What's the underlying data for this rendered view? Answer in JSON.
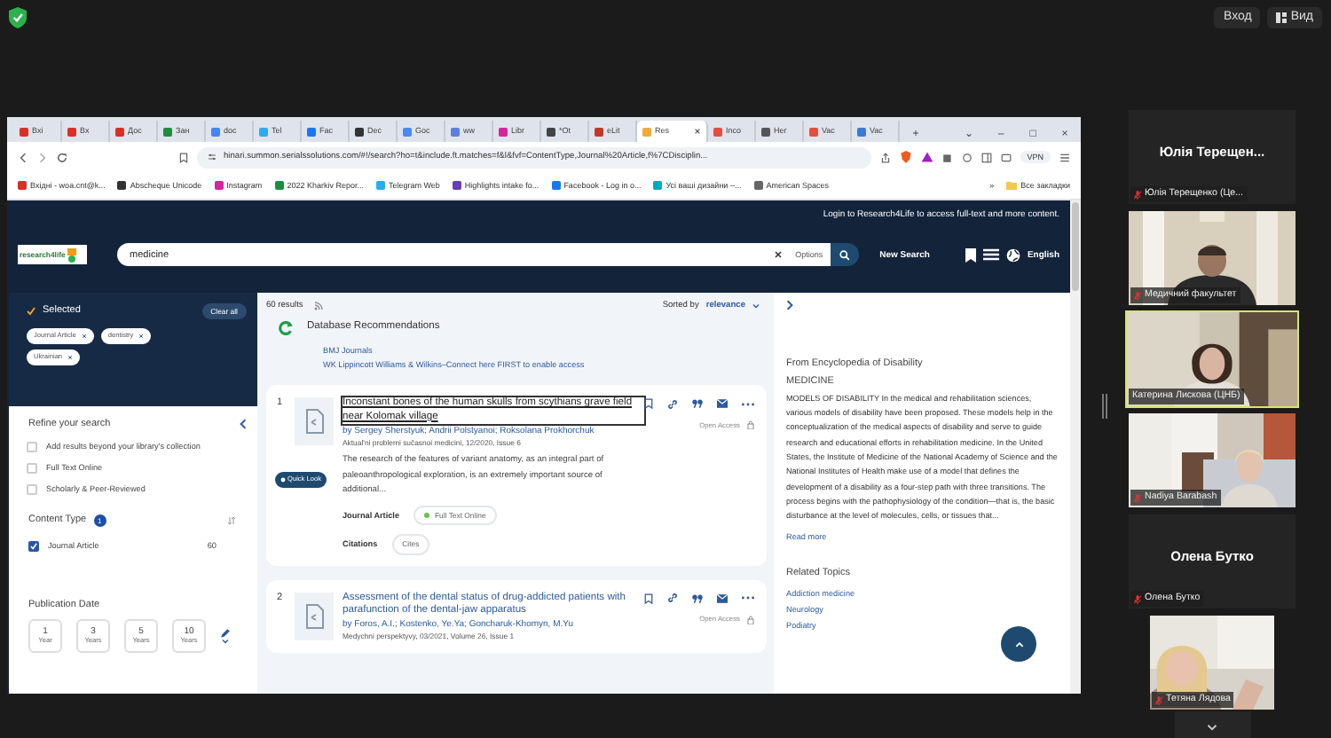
{
  "meeting": {
    "top_buttons": [
      "Вход",
      "Вид"
    ]
  },
  "browser": {
    "tabs": [
      {
        "label": "Вхі",
        "selected": false,
        "color": "#d93025"
      },
      {
        "label": "Вх",
        "selected": false,
        "color": "#d93025"
      },
      {
        "label": "Дос",
        "selected": false,
        "color": "#d93025"
      },
      {
        "label": "Зан",
        "selected": false,
        "color": "#1e8e3e"
      },
      {
        "label": "doc",
        "selected": false,
        "color": "#4285f4"
      },
      {
        "label": "Tel",
        "selected": false,
        "color": "#2aabee"
      },
      {
        "label": "Fac",
        "selected": false,
        "color": "#1877f2"
      },
      {
        "label": "Dec",
        "selected": false,
        "color": "#333333"
      },
      {
        "label": "Goc",
        "selected": false,
        "color": "#4a8af4"
      },
      {
        "label": "ww",
        "selected": false,
        "color": "#5b7fde"
      },
      {
        "label": "Libr",
        "selected": false,
        "color": "#d6249f"
      },
      {
        "label": "*Ot",
        "selected": false,
        "color": "#444444"
      },
      {
        "label": "eLit",
        "selected": false,
        "color": "#c0392b"
      },
      {
        "label": "Res",
        "selected": true,
        "color": "#f2a93b"
      },
      {
        "label": "Inco",
        "selected": false,
        "color": "#e74c3c"
      },
      {
        "label": "Her",
        "selected": false,
        "color": "#555555"
      },
      {
        "label": "Vac",
        "selected": false,
        "color": "#e74c3c"
      },
      {
        "label": "Vac",
        "selected": false,
        "color": "#3a7bd5"
      }
    ],
    "new_tab": "+",
    "window_controls": [
      "⌄",
      "–",
      "□",
      "×"
    ],
    "address": "hinari.summon.serialssolutions.com/#!/search?ho=t&include.ft.matches=f&l&fvf=ContentType,Journal%20Article,f%7CDisciplin...",
    "vpn": "VPN",
    "bookmarks": [
      {
        "label": "Вхідні - woa.cnt@k...",
        "color": "#d93025"
      },
      {
        "label": "Abscheque Unicode",
        "color": "#333333"
      },
      {
        "label": "Instagram",
        "color": "#d6249f"
      },
      {
        "label": "2022 Kharkiv Repor...",
        "color": "#1e8e3e"
      },
      {
        "label": "Telegram Web",
        "color": "#2aabee"
      },
      {
        "label": "Highlights intake fo...",
        "color": "#6a3fb5"
      },
      {
        "label": "Facebook - Log in o...",
        "color": "#1877f2"
      },
      {
        "label": "Усі ваші дизайни –...",
        "color": "#00a9c4"
      },
      {
        "label": "American Spaces",
        "color": "#666666"
      }
    ],
    "bookmarks_more": "»",
    "all_bookmarks": "Все закладки"
  },
  "site": {
    "login_notice": "Login to Research4Life to access full-text and more content.",
    "logo": "research4life",
    "search": {
      "value": "medicine"
    },
    "options": "Options",
    "new_search": "New Search",
    "language": "English"
  },
  "selected": {
    "title": "Selected",
    "clear": "Clear all",
    "chips": [
      "Journal Article",
      "dentistry",
      "Ukrainian"
    ]
  },
  "refine": {
    "title": "Refine your search",
    "options": [
      {
        "label": "Add results beyond your library's collection",
        "checked": false
      },
      {
        "label": "Full Text Online",
        "checked": false
      },
      {
        "label": "Scholarly & Peer-Reviewed",
        "checked": false
      }
    ]
  },
  "content_type": {
    "title": "Content Type",
    "count": "1",
    "items": [
      {
        "label": "Journal Article",
        "count": "60",
        "checked": true
      }
    ]
  },
  "publication_date": {
    "title": "Publication Date",
    "ranges": [
      {
        "value": "1",
        "unit": "Year"
      },
      {
        "value": "3",
        "unit": "Years"
      },
      {
        "value": "5",
        "unit": "Years"
      },
      {
        "value": "10",
        "unit": "Years"
      }
    ]
  },
  "results": {
    "count": "60 results",
    "sorted_by": "Sorted by",
    "sort": "relevance",
    "recommendations": {
      "title": "Database Recommendations",
      "links": [
        "BMJ Journals",
        "WK Lippincott Williams & Wilkins–Connect here FIRST to enable access"
      ]
    },
    "items": [
      {
        "number": "1",
        "title": "Inconstant bones of the human skulls from scythians grave field near Kolomak village",
        "focused": true,
        "authors": "by Sergey Sherstyuk; Andrii Polstyanoi; Roksolana Prokhorchuk",
        "source": "Aktual'ni problemi sučasnoi medicini, 12/2020, Issue 6",
        "access": "Open Access",
        "quick_look": "Quick Look",
        "abstract": "The research of the features of variant anatomy, as an integral part of paleoanthropological exploration, is an extremely important source of additional...",
        "type": "Journal Article",
        "availability": "Full Text Online",
        "citations": "Citations",
        "cites": "Cites"
      },
      {
        "number": "2",
        "title": "Assessment of the dental status of drug-addicted patients with parafunction of the dental-jaw apparatus",
        "focused": false,
        "authors": "by Foros, A.I.; Kostenko, Ye.Ya; Goncharuk-Khomyn, M.Yu",
        "source": "Medychni perspektyvy, 03/2021, Volume 26, Issue 1",
        "access": "Open Access"
      }
    ]
  },
  "encyclopedia": {
    "source": "From Encyclopedia of Disability",
    "heading": "MEDICINE",
    "text": "MODELS OF DISABILITY In the medical and rehabilitation sciences, various models of disability have been proposed. These models help in the conceptualization of the medical aspects of disability and serve to guide research and educational efforts in rehabilitation medicine. In the United States, the Institute of Medicine of the National Academy of Science and the National Institutes of Health make use of a model that defines the development of a disability as a four-step path with three transitions. The process begins with the pathophysiology of the condition—that is, the basic disturbance at the level of molecules, cells, or tissues that...",
    "read_more": "Read more",
    "related_title": "Related Topics",
    "related": [
      "Addiction medicine",
      "Neurology",
      "Podiatry"
    ]
  },
  "participants": [
    {
      "kind": "name",
      "display": "Юлія  Терещен...",
      "label": "Юлія Терещенко (Це...",
      "muted": true,
      "speaking": false
    },
    {
      "kind": "video",
      "label": "Медичний факультет",
      "muted": true,
      "speaking": false
    },
    {
      "kind": "video",
      "label": "Катерина Лискова (ЦНБ)",
      "muted": false,
      "speaking": true
    },
    {
      "kind": "video",
      "label": "Nadiya Barabash",
      "muted": true,
      "speaking": false
    },
    {
      "kind": "name",
      "display": "Олена Бутко",
      "label": "Олена Бутко",
      "muted": true,
      "speaking": false
    },
    {
      "kind": "video",
      "label": "Тетяна Лядова",
      "muted": true,
      "speaking": false
    }
  ]
}
